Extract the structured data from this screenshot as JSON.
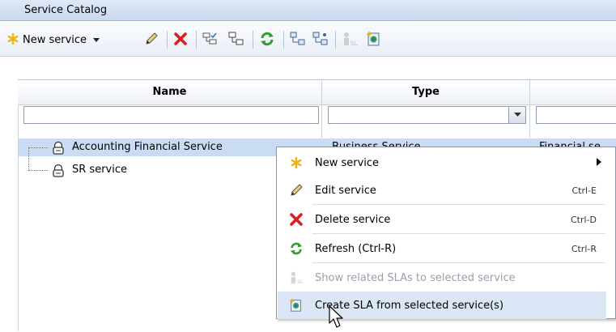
{
  "panel": {
    "title": "Service Catalog"
  },
  "toolbar": {
    "new_service_label": "New service",
    "icons": [
      "new-service-icon",
      "dropdown-arrow-icon",
      "edit-pencil-icon",
      "delete-x-icon",
      "check-tree-icon",
      "hierarchy-icon",
      "refresh-icon",
      "expand-icon",
      "collapse-icon",
      "related-sla-icon",
      "create-sla-icon"
    ]
  },
  "grid": {
    "columns": [
      {
        "label": "Name"
      },
      {
        "label": "Type"
      }
    ],
    "rows": [
      {
        "name": "Accounting Financial Service",
        "type": "Business Service",
        "extra": "Financial se"
      },
      {
        "name": "SR service",
        "type": "",
        "extra": ""
      }
    ]
  },
  "context_menu": {
    "items": [
      {
        "label": "New service",
        "shortcut": "",
        "icon": "asterisk-icon",
        "submenu": true,
        "enabled": true
      },
      {
        "label": "Edit service",
        "shortcut": "Ctrl-E",
        "icon": "pencil-icon",
        "enabled": true
      },
      {
        "label": "Delete service",
        "shortcut": "Ctrl-D",
        "icon": "delete-x-icon",
        "enabled": true
      },
      {
        "label": "Refresh (Ctrl-R)",
        "shortcut": "Ctrl-R",
        "icon": "refresh-icon",
        "enabled": true
      },
      {
        "label": "Show related SLAs to selected service",
        "shortcut": "",
        "icon": "related-sla-icon",
        "enabled": false
      },
      {
        "label": "Create SLA from selected service(s)",
        "shortcut": "",
        "icon": "create-sla-icon",
        "enabled": true,
        "hover": true
      }
    ]
  },
  "colors": {
    "accent_yellow": "#f0c020",
    "delete_red": "#d92020",
    "refresh_green": "#2e9e2e",
    "selected_row": "#c9dcf3"
  }
}
